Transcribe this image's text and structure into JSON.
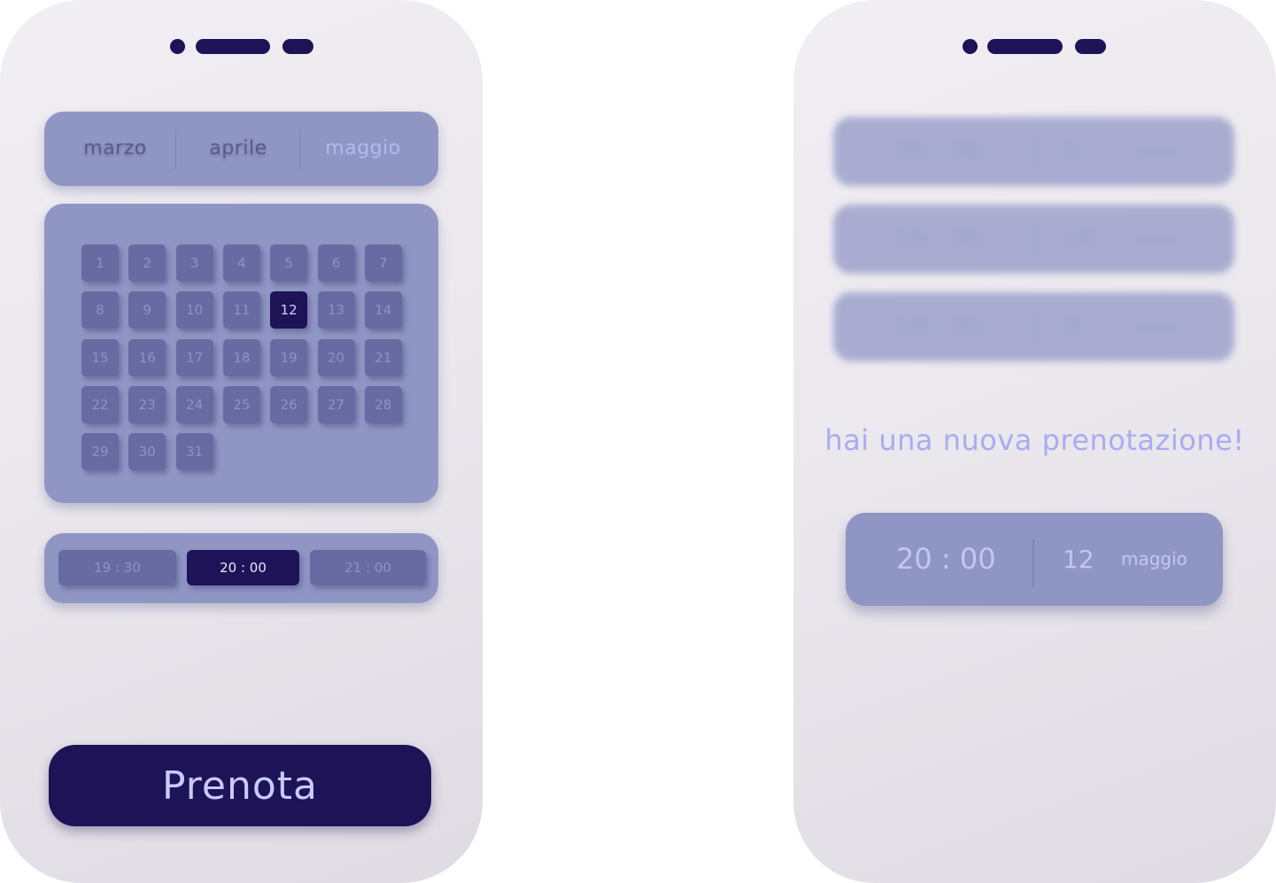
{
  "booking_screen": {
    "months": [
      {
        "label": "marzo",
        "active": false
      },
      {
        "label": "aprile",
        "active": false
      },
      {
        "label": "maggio",
        "active": true
      }
    ],
    "days": [
      "1",
      "2",
      "3",
      "4",
      "5",
      "6",
      "7",
      "8",
      "9",
      "10",
      "11",
      "12",
      "13",
      "14",
      "15",
      "16",
      "17",
      "18",
      "19",
      "20",
      "21",
      "22",
      "23",
      "24",
      "25",
      "26",
      "27",
      "28",
      "29",
      "30",
      "31"
    ],
    "selected_day": "12",
    "times": [
      {
        "label": "19 : 30",
        "selected": false
      },
      {
        "label": "20 : 00",
        "selected": true
      },
      {
        "label": "21 : 00",
        "selected": false
      }
    ],
    "book_button_label": "Prenota"
  },
  "confirmation_screen": {
    "blurred_bookings": [
      {
        "time": "20 : 00",
        "day": "5",
        "month": "aprile"
      },
      {
        "time": "19 : 00",
        "day": "18",
        "month": "marzo"
      },
      {
        "time": "19 : 30",
        "day": "8",
        "month": "marzo"
      }
    ],
    "notification": "hai una nuova prenotazione!",
    "new_booking": {
      "time": "20 : 00",
      "day": "12",
      "month": "maggio"
    }
  },
  "colors": {
    "accent_dark": "#1e1357",
    "card": "#9096c4",
    "tile": "#676ba1",
    "highlight_text": "#a9acf0"
  }
}
